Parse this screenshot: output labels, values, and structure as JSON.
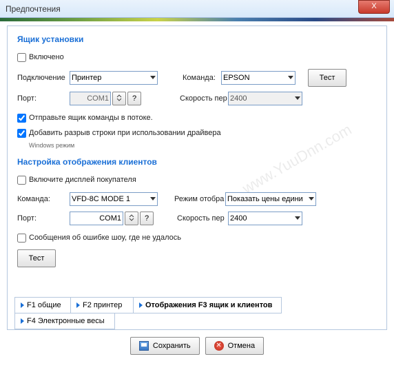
{
  "window": {
    "title": "Предпочтения",
    "close": "X"
  },
  "section1": {
    "title": "Ящик установки",
    "enabled_label": "Включено",
    "connection_label": "Подключение",
    "connection_value": "Принтер",
    "team_label": "Команда:",
    "team_value": "EPSON",
    "port_label": "Порт:",
    "port_value": "COM1",
    "stepper_down": "",
    "help": "?",
    "speed_label": "Скорость пер",
    "speed_value": "2400",
    "test_btn": "Тест",
    "send_label": "Отправьте ящик команды в потоке.",
    "add_break_label": "Добавить разрыв строки при использовании драйвера",
    "windows_mode_label": "Windows режим"
  },
  "section2": {
    "title": "Настройка отображения клиентов",
    "enable_display_label": "Включите дисплей покупателя",
    "team_label": "Команда:",
    "team_value": "VFD-8C MODE 1",
    "mode_label": "Режим отобра",
    "mode_value": "Показать цены единиц",
    "port_label": "Порт:",
    "port_value": "COM1",
    "help": "?",
    "speed_label": "Скорость пер",
    "speed_value": "2400",
    "error_msg_label": "Сообщения об ошибке шоу, где не удалось",
    "test_btn": "Тест"
  },
  "tabs": {
    "t1": "F1 общие",
    "t2": "F2 принтер",
    "t3": "Отображения F3 ящик и клиентов",
    "t4": "F4 Электронные весы"
  },
  "footer": {
    "save": "Сохранить",
    "cancel": "Отмена"
  },
  "watermark": "www.YuuDnn.com"
}
